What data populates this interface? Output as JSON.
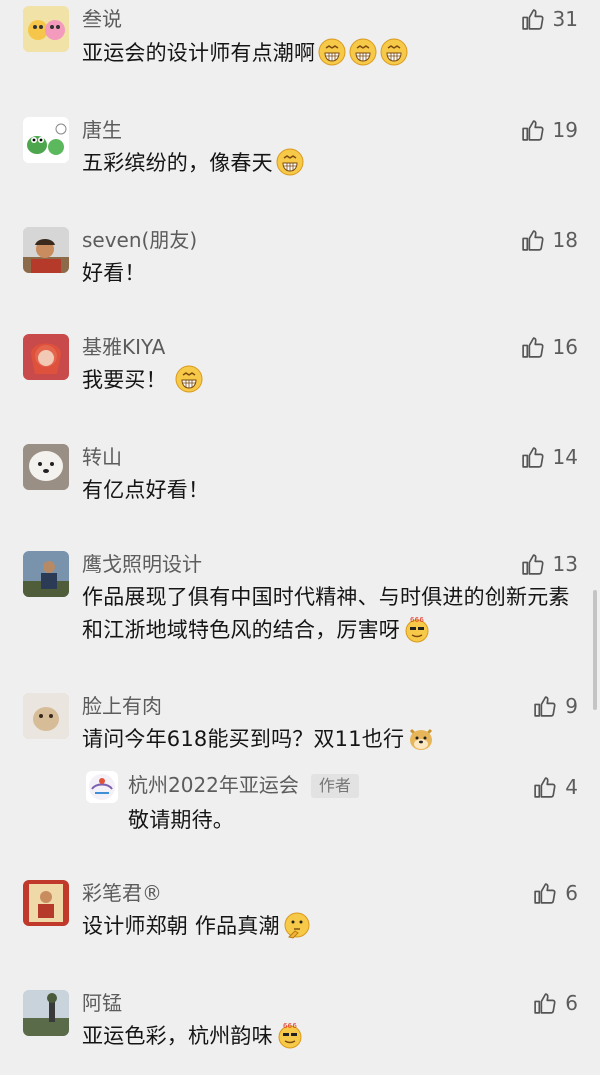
{
  "comments": [
    {
      "name": "叁说",
      "text": "亚运会的设计师有点潮啊",
      "likes": "31",
      "emoji": "grin-face-icon x3"
    },
    {
      "name": "唐生",
      "text": "五彩缤纷的，像春天",
      "likes": "19",
      "emoji": "grin-face-icon"
    },
    {
      "name": "seven(朋友)",
      "text": "好看！",
      "likes": "18"
    },
    {
      "name": "基雅KIYA",
      "text": "我要买！",
      "likes": "16",
      "emoji": "grin-face-icon"
    },
    {
      "name": "转山",
      "text": "有亿点好看！",
      "likes": "14"
    },
    {
      "name": "鹰戈照明设计",
      "text": "作品展现了俱有中国时代精神、与时俱进的创新元素和江浙地域特色风的结合，厉害呀",
      "likes": "13",
      "emoji": "666-face-icon"
    },
    {
      "name": "脸上有肉",
      "text": "请问今年618能买到吗？双11也行",
      "likes": "9",
      "emoji": "doge-icon"
    },
    {
      "name": "杭州2022年亚运会",
      "badge": "作者",
      "text": "敬请期待。",
      "likes": "4"
    },
    {
      "name": "彩笔君®",
      "text": "设计师郑朝 作品真潮",
      "likes": "6",
      "emoji": "thinking-face-icon"
    },
    {
      "name": "阿锰",
      "text": "亚运色彩，杭州韵味",
      "likes": "6",
      "emoji": "666-face-icon"
    }
  ]
}
